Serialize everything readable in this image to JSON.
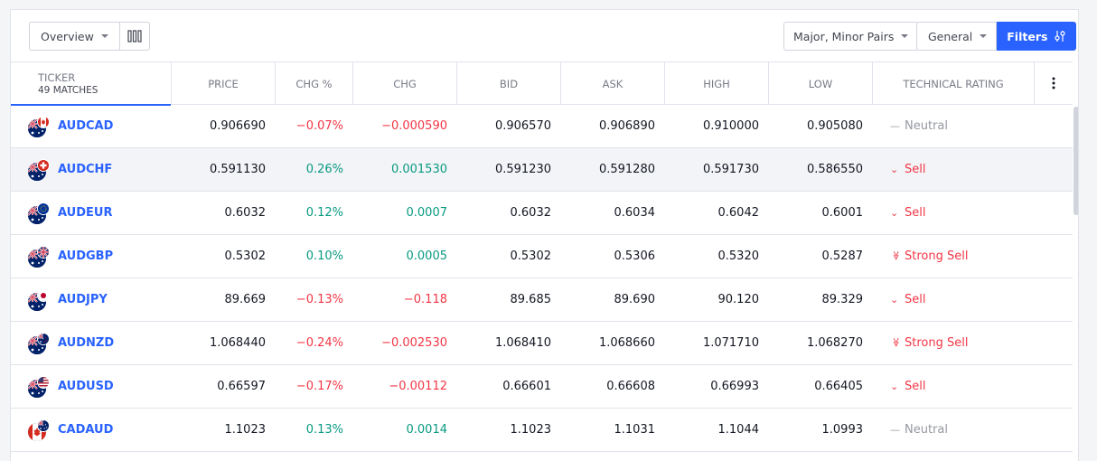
{
  "toolbar": {
    "view_label": "Overview",
    "pairs_label": "Major, Minor Pairs",
    "general_label": "General",
    "filters_label": "Filters"
  },
  "columns": {
    "ticker": "Ticker",
    "matches": "49 matches",
    "price": "Price",
    "chg_pct": "Chg %",
    "chg": "Chg",
    "bid": "Bid",
    "ask": "Ask",
    "high": "High",
    "low": "Low",
    "rating": "Technical Rating"
  },
  "colors": {
    "accent": "#2962ff",
    "positive": "#089981",
    "negative": "#f23645",
    "neutral": "#9598a1"
  },
  "rows": [
    {
      "symbol": "AUDCAD",
      "price": "0.906690",
      "chg_pct": "−0.07%",
      "chg": "−0.000590",
      "bid": "0.906570",
      "ask": "0.906890",
      "high": "0.910000",
      "low": "0.905080",
      "rating": "Neutral",
      "rating_icon": "dash-icon",
      "dir": "neg",
      "base_flag": "AU",
      "quote_flag": "CA"
    },
    {
      "symbol": "AUDCHF",
      "price": "0.591130",
      "chg_pct": "0.26%",
      "chg": "0.001530",
      "bid": "0.591230",
      "ask": "0.591280",
      "high": "0.591730",
      "low": "0.586550",
      "rating": "Sell",
      "rating_icon": "chevron-down-icon",
      "dir": "pos",
      "base_flag": "AU",
      "quote_flag": "CH"
    },
    {
      "symbol": "AUDEUR",
      "price": "0.6032",
      "chg_pct": "0.12%",
      "chg": "0.0007",
      "bid": "0.6032",
      "ask": "0.6034",
      "high": "0.6042",
      "low": "0.6001",
      "rating": "Sell",
      "rating_icon": "chevron-down-icon",
      "dir": "pos",
      "base_flag": "AU",
      "quote_flag": "EU"
    },
    {
      "symbol": "AUDGBP",
      "price": "0.5302",
      "chg_pct": "0.10%",
      "chg": "0.0005",
      "bid": "0.5302",
      "ask": "0.5306",
      "high": "0.5320",
      "low": "0.5287",
      "rating": "Strong Sell",
      "rating_icon": "double-chevron-down-icon",
      "dir": "pos",
      "base_flag": "AU",
      "quote_flag": "GB"
    },
    {
      "symbol": "AUDJPY",
      "price": "89.669",
      "chg_pct": "−0.13%",
      "chg": "−0.118",
      "bid": "89.685",
      "ask": "89.690",
      "high": "90.120",
      "low": "89.329",
      "rating": "Sell",
      "rating_icon": "chevron-down-icon",
      "dir": "neg",
      "base_flag": "AU",
      "quote_flag": "JP"
    },
    {
      "symbol": "AUDNZD",
      "price": "1.068440",
      "chg_pct": "−0.24%",
      "chg": "−0.002530",
      "bid": "1.068410",
      "ask": "1.068660",
      "high": "1.071710",
      "low": "1.068270",
      "rating": "Strong Sell",
      "rating_icon": "double-chevron-down-icon",
      "dir": "neg",
      "base_flag": "AU",
      "quote_flag": "NZ"
    },
    {
      "symbol": "AUDUSD",
      "price": "0.66597",
      "chg_pct": "−0.17%",
      "chg": "−0.00112",
      "bid": "0.66601",
      "ask": "0.66608",
      "high": "0.66993",
      "low": "0.66405",
      "rating": "Sell",
      "rating_icon": "chevron-down-icon",
      "dir": "neg",
      "base_flag": "AU",
      "quote_flag": "US"
    },
    {
      "symbol": "CADAUD",
      "price": "1.1023",
      "chg_pct": "0.13%",
      "chg": "0.0014",
      "bid": "1.1023",
      "ask": "1.1031",
      "high": "1.1044",
      "low": "1.0993",
      "rating": "Neutral",
      "rating_icon": "dash-icon",
      "dir": "pos",
      "base_flag": "CA",
      "quote_flag": "AU"
    }
  ]
}
